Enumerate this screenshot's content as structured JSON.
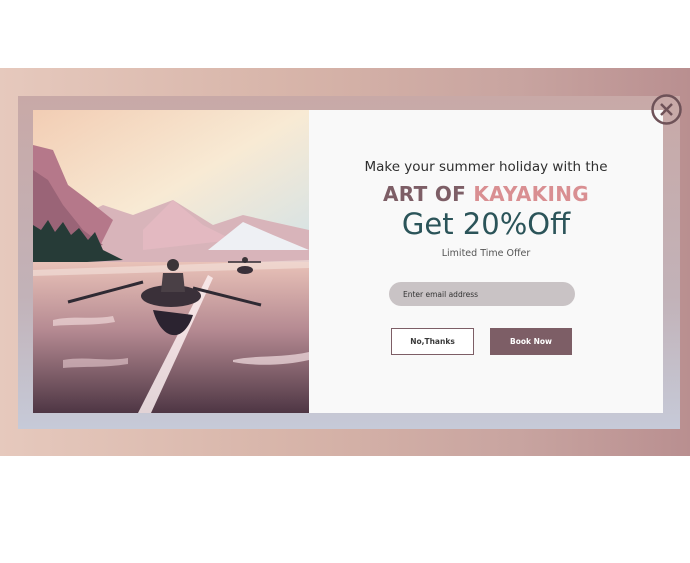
{
  "popup": {
    "headline": "Make your summer holiday with the",
    "brand_part1": "ART OF",
    "brand_part2": "KAYAKING",
    "offer": "Get 20%Off",
    "limited": "Limited Time Offer",
    "email_placeholder": "Enter email address",
    "decline_label": "No,Thanks",
    "book_label": "Book Now",
    "close_icon": "close-circle-icon",
    "image_description": "kayaking-lake-illustration"
  },
  "colors": {
    "accent": "#7d5e66",
    "brand_highlight": "#d98f92",
    "offer_text": "#2b5459",
    "input_bg": "#c9c3c5"
  }
}
